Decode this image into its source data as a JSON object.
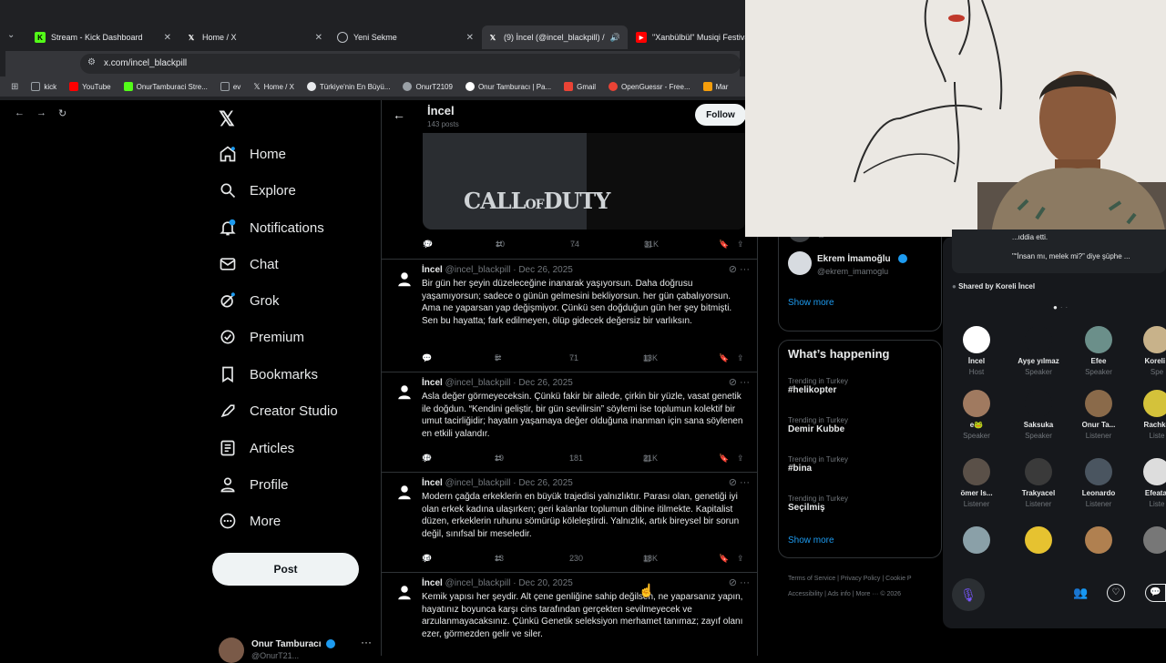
{
  "browser": {
    "tabs": [
      {
        "label": "Stream - Kick Dashboard",
        "icon": "kick-icon"
      },
      {
        "label": "Home / X",
        "icon": "x-logo-icon"
      },
      {
        "label": "Yeni Sekme",
        "icon": "chrome-icon"
      },
      {
        "label": "(9) İncel (@incel_blackpill) /",
        "icon": "x-logo-icon"
      },
      {
        "label": "\"Xanbülbül\" Musiqi Festivalı",
        "icon": "youtube-icon"
      }
    ],
    "url": "x.com/incel_blackpill",
    "bookmarks": [
      {
        "label": "kick",
        "color": "#9aa0a6"
      },
      {
        "label": "YouTube",
        "color": "#ff0000"
      },
      {
        "label": "OnurTamburaci Stre...",
        "color": "#53fc18"
      },
      {
        "label": "ev",
        "color": "#9aa0a6"
      },
      {
        "label": "Home / X",
        "color": "#ffffff"
      },
      {
        "label": "Türkiye'nin En Büyü...",
        "color": "#e8eaed"
      },
      {
        "label": "OnurT2109",
        "color": "#9aa0a6"
      },
      {
        "label": "Onur Tamburacı | Pa...",
        "color": "#ffffff"
      },
      {
        "label": "Gmail",
        "color": "#ea4335"
      },
      {
        "label": "OpenGuessr - Free...",
        "color": "#ea4335"
      },
      {
        "label": "Mar",
        "color": "#f59e0b"
      }
    ]
  },
  "nav": {
    "items": [
      {
        "label": "Home",
        "icon": "home-icon"
      },
      {
        "label": "Explore",
        "icon": "search-icon"
      },
      {
        "label": "Notifications",
        "icon": "bell-icon"
      },
      {
        "label": "Chat",
        "icon": "mail-icon"
      },
      {
        "label": "Grok",
        "icon": "grok-icon"
      },
      {
        "label": "Premium",
        "icon": "verified-icon"
      },
      {
        "label": "Bookmarks",
        "icon": "bookmark-icon"
      },
      {
        "label": "Creator Studio",
        "icon": "rocket-icon"
      },
      {
        "label": "Articles",
        "icon": "article-icon"
      },
      {
        "label": "Profile",
        "icon": "person-icon"
      },
      {
        "label": "More",
        "icon": "more-icon"
      }
    ],
    "notif_badge": "",
    "post_label": "Post",
    "account_name": "Onur Tamburacı",
    "account_handle": "@OnurT21..."
  },
  "profile_header": {
    "name": "İncel",
    "posts": "143 posts",
    "follow_label": "Follow"
  },
  "media_tweet_stats": {
    "replies": "17",
    "reposts": "10",
    "likes": "74",
    "views": "31K"
  },
  "tweets": [
    {
      "name": "İncel",
      "handle": "@incel_blackpill",
      "date": "· Dec 26, 2025",
      "text": "Bir gün her şeyin düzeleceğine inanarak yaşıyorsun. Daha doğrusu yaşamıyorsun; sadece o günün gelmesini bekliyorsun. her gün çabalıyorsun. Ama ne yaparsan yap değişmiyor. Çünkü sen doğduğun gün her şey bitmişti. Sen bu hayatta; fark edilmeyen, ölüp gidecek değersiz bir varlıksın.",
      "replies": "",
      "reposts": "5",
      "likes": "71",
      "views": "13K"
    },
    {
      "name": "İncel",
      "handle": "@incel_blackpill",
      "date": "· Dec 26, 2025",
      "text": "Asla değer görmeyeceksin. Çünkü fakir bir ailede, çirkin bir yüzle, vasat genetik ile doğdun. “Kendini geliştir, bir gün sevilirsin” söylemi ise toplumun kolektif bir umut tacirliğidir; hayatın yaşamaya değer olduğuna inanman için sana söylenen en etkili yalandır.",
      "replies": "18",
      "reposts": "19",
      "likes": "181",
      "views": "21K"
    },
    {
      "name": "İncel",
      "handle": "@incel_blackpill",
      "date": "· Dec 26, 2025",
      "text": "Modern çağda erkeklerin en büyük trajedisi yalnızlıktır. Parası olan, genetiği iyi olan erkek kadına ulaşırken; geri kalanlar toplumun dibine itilmekte. Kapitalist düzen, erkeklerin ruhunu sömürüp köleleştirdi. Yalnızlık, artık bireysel bir sorun değil, sınıfsal bir meseledir.",
      "replies": "14",
      "reposts": "13",
      "likes": "230",
      "views": "18K"
    },
    {
      "name": "İncel",
      "handle": "@incel_blackpill",
      "date": "· Dec 20, 2025",
      "text": "Kemik yapısı her şeydir. Alt çene genliğine sahip değilsen, ne yaparsanız yapın, hayatınız boyunca karşı cins tarafından gerçekten sevilmeyecek ve arzulanmayacaksınız. Çünkü Genetik seleksiyon merhamet tanımaz; zayıf olanı ezer, görmezden gelir ve siler.",
      "replies": "",
      "reposts": "",
      "likes": "",
      "views": ""
    }
  ],
  "right": {
    "follow_suggestions": [
      {
        "name": "",
        "handle": "@TeleKizz"
      },
      {
        "name": "Ekrem İmamoğlu",
        "handle": "@ekrem_imamoglu"
      }
    ],
    "show_more": "Show more",
    "whats_happening": "What’s happening",
    "trends": [
      {
        "context": "Trending in Turkey",
        "topic": "#helikopter"
      },
      {
        "context": "Trending in Turkey",
        "topic": "Demir Kubbe"
      },
      {
        "context": "Trending in Turkey",
        "topic": "#bina"
      },
      {
        "context": "Trending in Turkey",
        "topic": "Seçilmiş"
      }
    ],
    "show_more_2": "Show more",
    "footer": [
      "Terms of Service",
      "|",
      "Privacy Policy",
      "|",
      "Cookie P",
      "Accessibility",
      "|",
      "Ads info",
      "|",
      "More ···",
      "© 2026"
    ]
  },
  "spaces": {
    "quote_line1": "...ıddia etti.",
    "quote_line2": "\"“İnsan mı, melek mi?” diye şüphe ...",
    "shared_by": "Shared by Koreli İncel",
    "participants": [
      {
        "name": "İncel",
        "role": "Host",
        "color": "#ffffff"
      },
      {
        "name": "Ayşe yılmaz",
        "role": "Speaker",
        "color": "#16181c"
      },
      {
        "name": "Efee",
        "role": "Speaker",
        "color": "#6b8f8a"
      },
      {
        "name": "Koreli İ",
        "role": "Spe",
        "color": "#c8b28a"
      },
      {
        "name": "e🐸",
        "role": "Speaker",
        "color": "#a07a60"
      },
      {
        "name": "Saksuka",
        "role": "Speaker",
        "color": "#16181c"
      },
      {
        "name": "Onur Ta...",
        "role": "Listener",
        "color": "#8a6a4a"
      },
      {
        "name": "Rachko",
        "role": "Liste",
        "color": "#d4c23a"
      },
      {
        "name": "ömer ls...",
        "role": "Listener",
        "color": "#5a5048"
      },
      {
        "name": "Trakyacel",
        "role": "Listener",
        "color": "#3a3a3a"
      },
      {
        "name": "Leonardo",
        "role": "Listener",
        "color": "#4a5560"
      },
      {
        "name": "Efeatal",
        "role": "Liste",
        "color": "#dddddd"
      },
      {
        "name": "",
        "role": "",
        "color": "#8aa0a8"
      },
      {
        "name": "",
        "role": "",
        "color": "#e6c230"
      },
      {
        "name": "",
        "role": "",
        "color": "#b08050"
      },
      {
        "name": "",
        "role": "",
        "color": "#777777"
      }
    ]
  },
  "colors": {
    "accent": "#1d9bf0",
    "bg": "#000000",
    "border": "#2f3336",
    "muted": "#71767b",
    "host_mic": "#f4212e",
    "spaces_purple": "#7856ff"
  }
}
